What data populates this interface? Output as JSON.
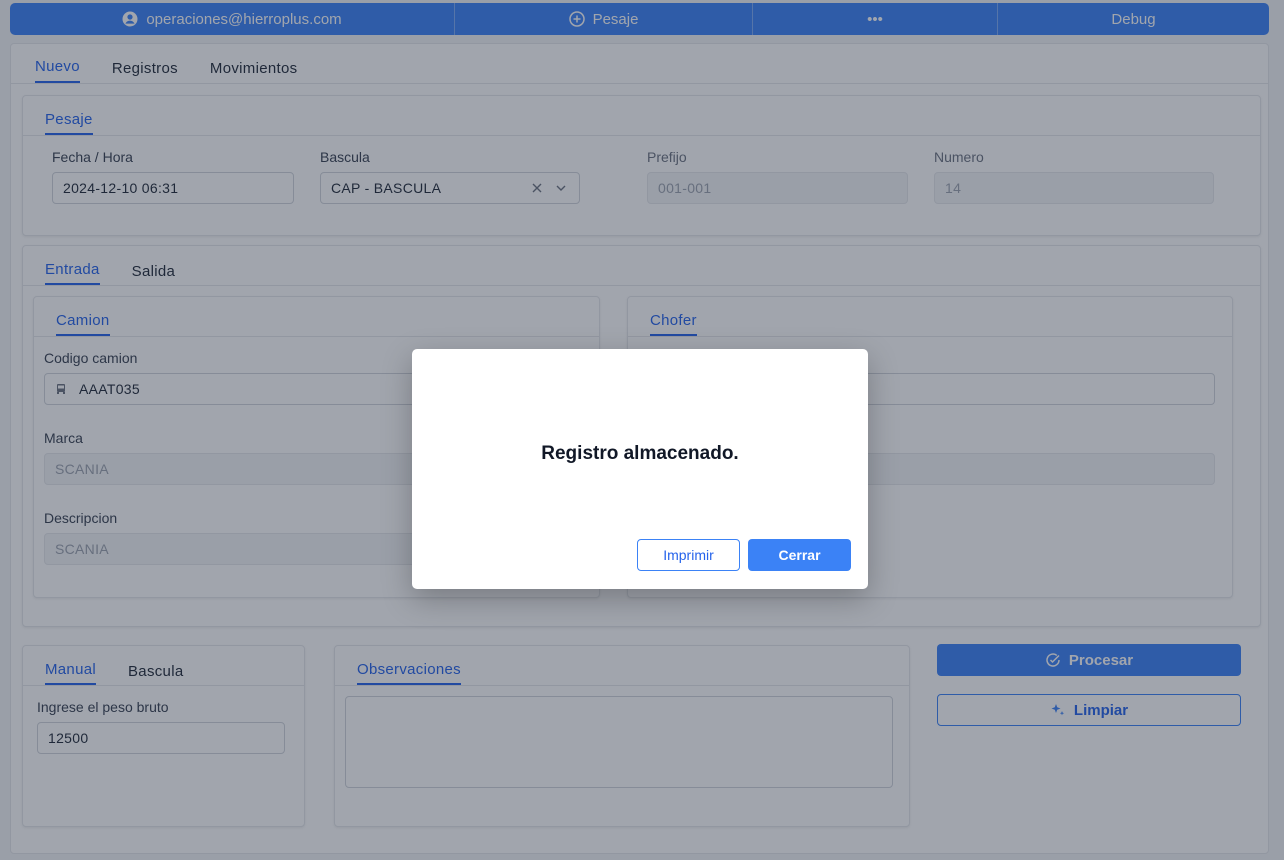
{
  "topbar": {
    "user": "operaciones@hierroplus.com",
    "pesaje": "Pesaje",
    "more": "•••",
    "debug": "Debug"
  },
  "main_tabs": [
    "Nuevo",
    "Registros",
    "Movimientos"
  ],
  "pesaje": {
    "tab": "Pesaje",
    "fecha_label": "Fecha / Hora",
    "fecha_value": "2024-12-10 06:31",
    "bascula_label": "Bascula",
    "bascula_value": "CAP - BASCULA",
    "prefijo_label": "Prefijo",
    "prefijo_value": "001-001",
    "numero_label": "Numero",
    "numero_value": "14"
  },
  "movement_tabs": [
    "Entrada",
    "Salida"
  ],
  "camion": {
    "tab": "Camion",
    "codigo_label": "Codigo camion",
    "codigo_value": "AAAT035",
    "marca_label": "Marca",
    "marca_value": "SCANIA",
    "descripcion_label": "Descripcion",
    "descripcion_value": "SCANIA"
  },
  "chofer": {
    "tab": "Chofer"
  },
  "peso": {
    "tabs": [
      "Manual",
      "Bascula"
    ],
    "label": "Ingrese el peso bruto",
    "value": "12500"
  },
  "observaciones": {
    "tab": "Observaciones"
  },
  "actions": {
    "procesar": "Procesar",
    "limpiar": "Limpiar"
  },
  "modal": {
    "message": "Registro almacenado.",
    "print": "Imprimir",
    "close": "Cerrar"
  },
  "colors": {
    "accent": "#3b82f6",
    "overlay": "#1e293b"
  }
}
